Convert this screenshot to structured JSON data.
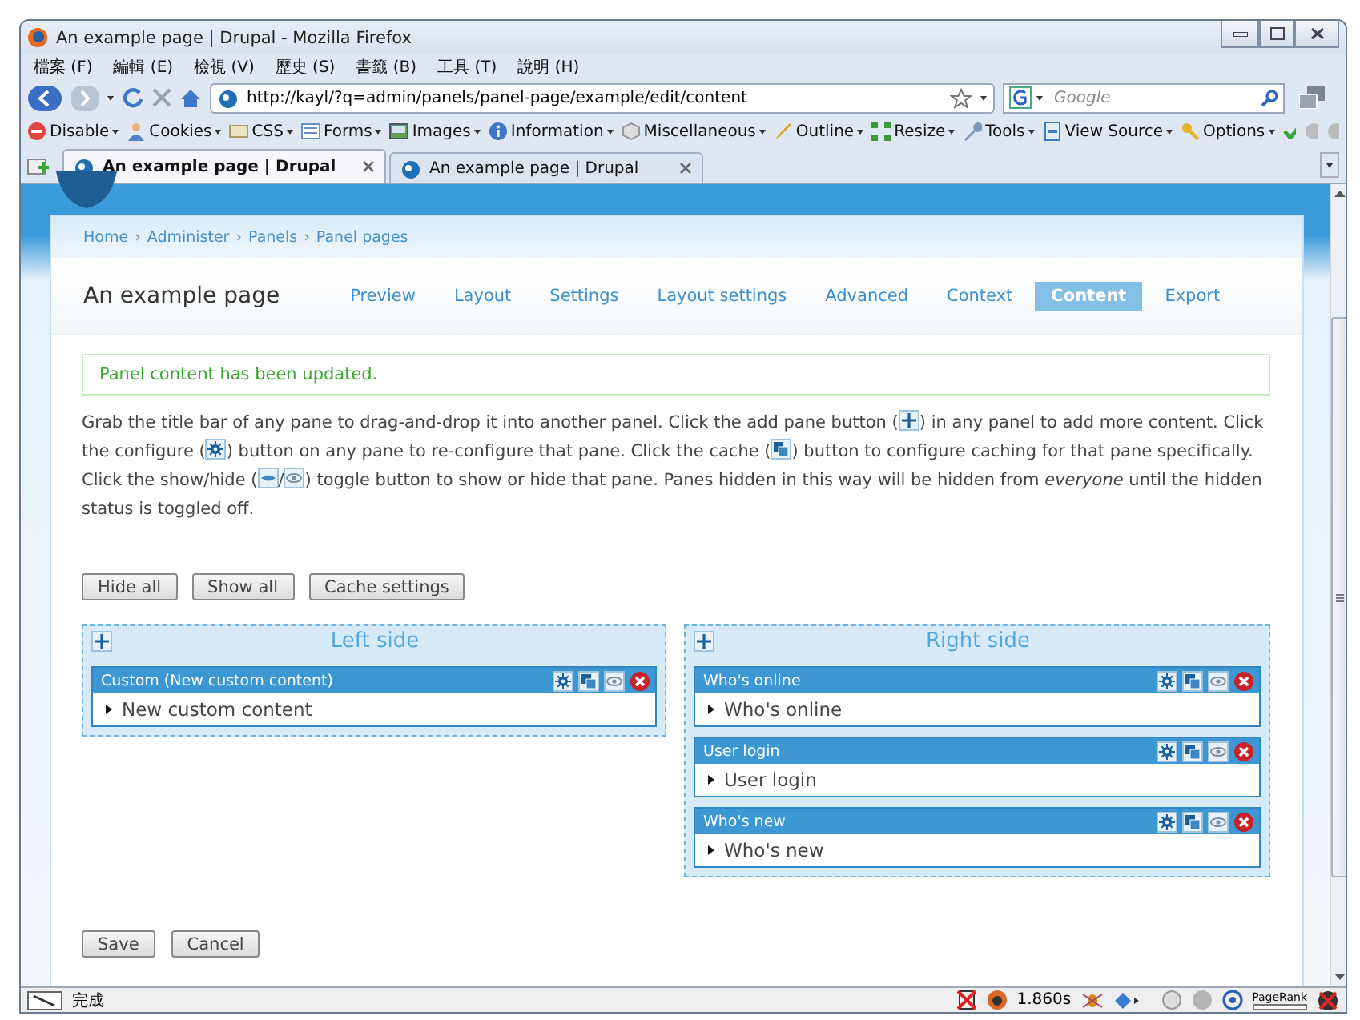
{
  "window": {
    "title": "An example page | Drupal - Mozilla Firefox"
  },
  "menu_bar": [
    "檔案 (F)",
    "編輯 (E)",
    "檢視 (V)",
    "歷史 (S)",
    "書籤 (B)",
    "工具 (T)",
    "說明 (H)"
  ],
  "nav_bar": {
    "url": "http://kayl/?q=admin/panels/panel-page/example/edit/content",
    "search_placeholder": "Google"
  },
  "dev_toolbar": [
    "Disable",
    "Cookies",
    "CSS",
    "Forms",
    "Images",
    "Information",
    "Miscellaneous",
    "Outline",
    "Resize",
    "Tools",
    "View Source",
    "Options"
  ],
  "tabs": [
    {
      "label": "An example page | Drupal",
      "selected": true
    },
    {
      "label": "An example page | Drupal",
      "selected": false
    }
  ],
  "breadcrumb": {
    "separator": "›",
    "items": [
      "Home",
      "Administer",
      "Panels",
      "Panel pages"
    ]
  },
  "page_title": "An example page",
  "page_tabs": [
    {
      "label": "Preview",
      "selected": false
    },
    {
      "label": "Layout",
      "selected": false
    },
    {
      "label": "Settings",
      "selected": false
    },
    {
      "label": "Layout settings",
      "selected": false
    },
    {
      "label": "Advanced",
      "selected": false
    },
    {
      "label": "Context",
      "selected": false
    },
    {
      "label": "Content",
      "selected": true
    },
    {
      "label": "Export",
      "selected": false
    }
  ],
  "message": "Panel content has been updated.",
  "help_text": [
    {
      "kind": "text",
      "text": "Grab the title bar of any pane to drag-and-drop it into another panel. Click the add pane button ("
    },
    {
      "kind": "add"
    },
    {
      "kind": "text",
      "text": ") in any panel to add more content. Click the configure ("
    },
    {
      "kind": "gear"
    },
    {
      "kind": "text",
      "text": ") button on any pane to re-configure that pane. Click the cache ("
    },
    {
      "kind": "cache"
    },
    {
      "kind": "text",
      "text": ") button to configure caching for that pane specifically. Click the show/hide ("
    },
    {
      "kind": "hidden"
    },
    {
      "kind": "text",
      "text": "/"
    },
    {
      "kind": "eye"
    },
    {
      "kind": "text",
      "text": ") toggle button to show or hide that pane. Panes hidden in this way will be hidden from *everyone* until the hidden status is toggled off."
    }
  ],
  "buttons": [
    "Hide all",
    "Show all",
    "Cache settings"
  ],
  "panels": [
    {
      "title": "Left side",
      "panes": [
        {
          "title": "Custom (New custom content)",
          "content": "New custom content"
        }
      ]
    },
    {
      "title": "Right side",
      "panes": [
        {
          "title": "Who's online",
          "content": "Who's online"
        },
        {
          "title": "User login",
          "content": "User login"
        },
        {
          "title": "Who's new",
          "content": "Who's new"
        }
      ]
    }
  ],
  "form_buttons": [
    "Save",
    "Cancel"
  ],
  "status_bar": {
    "text": "完成",
    "timing": "1.860s",
    "pagerank_label": "PageRank"
  }
}
